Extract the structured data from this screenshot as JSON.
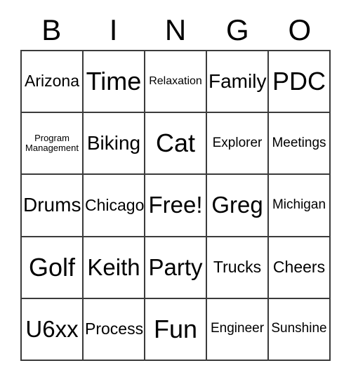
{
  "card": {
    "title": "BINGO",
    "header_letters": [
      "B",
      "I",
      "N",
      "G",
      "O"
    ],
    "free_space_label": "Free!",
    "border_color": "#3b3b3b",
    "text_color": "#000000",
    "background_color": "#ffffff",
    "rows": [
      [
        {
          "label": "Arizona",
          "size": "m"
        },
        {
          "label": "Time",
          "size": "xxl"
        },
        {
          "label": "Relaxation",
          "size": "xs"
        },
        {
          "label": "Family",
          "size": "l"
        },
        {
          "label": "PDC",
          "size": "xxl"
        }
      ],
      [
        {
          "label": "Program\nManagement",
          "size": "xxs"
        },
        {
          "label": "Biking",
          "size": "l"
        },
        {
          "label": "Cat",
          "size": "xxl"
        },
        {
          "label": "Explorer",
          "size": "s"
        },
        {
          "label": "Meetings",
          "size": "s"
        }
      ],
      [
        {
          "label": "Drums",
          "size": "l"
        },
        {
          "label": "Chicago",
          "size": "m"
        },
        {
          "label": "Free!",
          "size": "xl"
        },
        {
          "label": "Greg",
          "size": "xl"
        },
        {
          "label": "Michigan",
          "size": "s"
        }
      ],
      [
        {
          "label": "Golf",
          "size": "xxl"
        },
        {
          "label": "Keith",
          "size": "xl"
        },
        {
          "label": "Party",
          "size": "xl"
        },
        {
          "label": "Trucks",
          "size": "m"
        },
        {
          "label": "Cheers",
          "size": "m"
        }
      ],
      [
        {
          "label": "U6xx",
          "size": "xl"
        },
        {
          "label": "Process",
          "size": "m"
        },
        {
          "label": "Fun",
          "size": "xxl"
        },
        {
          "label": "Engineer",
          "size": "s"
        },
        {
          "label": "Sunshine",
          "size": "s"
        }
      ]
    ]
  }
}
